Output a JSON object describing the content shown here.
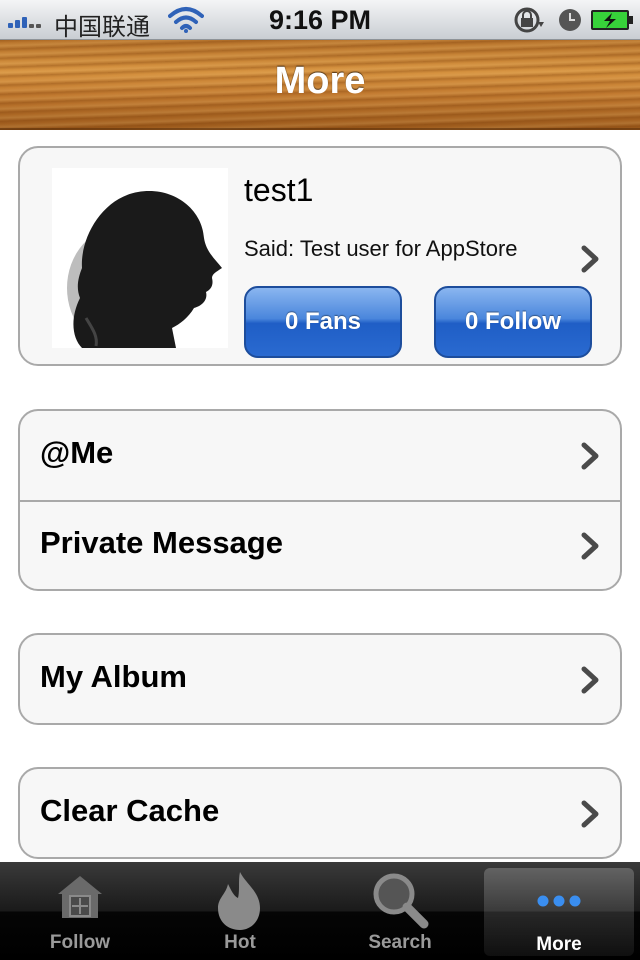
{
  "status_bar": {
    "carrier": "中国联通",
    "time": "9:16 PM",
    "icons": [
      "signal-icon",
      "wifi-icon",
      "rotation-lock-icon",
      "alarm-icon",
      "battery-charging-icon"
    ]
  },
  "nav": {
    "title": "More"
  },
  "profile": {
    "username": "test1",
    "said": "Said: Test user for AppStore",
    "fans_label": "0 Fans",
    "follow_label": "0 Follow"
  },
  "menu_groups": [
    {
      "items": [
        "@Me",
        "Private Message"
      ]
    },
    {
      "items": [
        "My Album"
      ]
    },
    {
      "items": [
        "Clear Cache"
      ]
    }
  ],
  "tabs": [
    {
      "label": "Follow",
      "icon": "house-icon",
      "active": false
    },
    {
      "label": "Hot",
      "icon": "flame-icon",
      "active": false
    },
    {
      "label": "Search",
      "icon": "magnifier-icon",
      "active": false
    },
    {
      "label": "More",
      "icon": "more-dots-icon",
      "active": true
    }
  ],
  "colors": {
    "accent_blue": "#2a6ad0",
    "nav_wood": "#c27a30",
    "active_dots": "#3a8ef0"
  }
}
